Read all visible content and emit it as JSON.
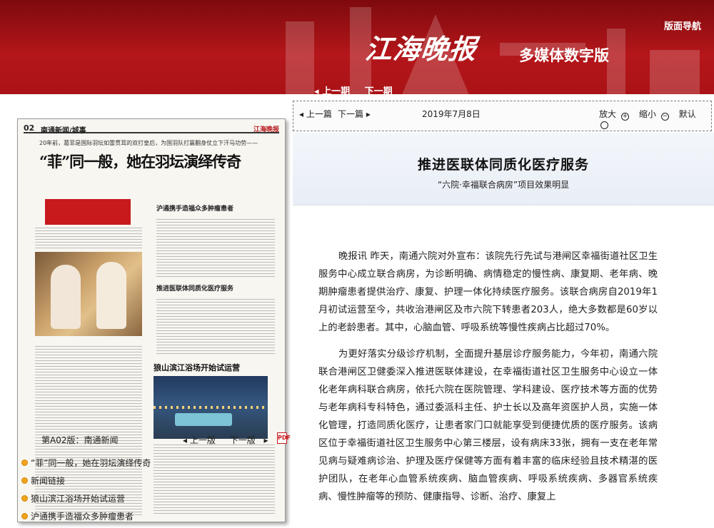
{
  "header": {
    "nav_label": "版面导航",
    "logo_text": "江海晚报",
    "logo_subtitle": "多媒体数字版",
    "issue_prev": "上一期",
    "issue_next": "下一期"
  },
  "newspaper_page": {
    "page_number": "02",
    "page_section": "南通新闻/城事",
    "brand": "江海晚报",
    "kicker": "20年前，葛菲是国际羽坛如雷贯耳的双打皇后，为国羽队打赢翻身仗立下汗马功劳——",
    "headline": "“菲”同一般，她在羽坛演绎传奇",
    "story2_title": "沪通携手造福众多肿瘤患者",
    "story3_title": "推进医联体同质化医疗服务",
    "story4_title": "狼山滨江浴场开始试运营"
  },
  "page_nav": {
    "page_info": "第A02版：南通新闻",
    "prev_page": "上一版",
    "next_page": "下一版",
    "pdf_icon": "pdf-icon"
  },
  "articles": [
    "“菲”同一般，她在羽坛演绎传奇",
    "新闻链接",
    "狼山滨江浴场开始试运营",
    "沪通携手造福众多肿瘤患者"
  ],
  "toolbar": {
    "prev_article": "上一篇",
    "next_article": "下一篇",
    "date": "2019年7月8日",
    "zoom_in": "放大",
    "zoom_out": "缩小",
    "zoom_default": "默认"
  },
  "article": {
    "title": "推进医联体同质化医疗服务",
    "subtitle": "“六院·幸福联合病房”项目效果明显",
    "paragraphs": [
      "晚报讯 昨天，南通六院对外宣布：该院先行先试与港闸区幸福街道社区卫生服务中心成立联合病房，为诊断明确、病情稳定的慢性病、康复期、老年病、晚期肿瘤患者提供治疗、康复、护理一体化持续医疗服务。该联合病房自2019年1月初试运营至今，共收治港闸区及市六院下转患者203人，绝大多数都是60岁以上的老龄患者。其中，心脑血管、呼吸系统等慢性疾病占比超过70%。",
      "为更好落实分级诊疗机制，全面提升基层诊疗服务能力，今年初，南通六院联合港闸区卫健委深入推进医联体建设，在幸福街道社区卫生服务中心设立一体化老年病科联合病房，依托六院在医院管理、学科建设、医疗技术等方面的优势与老年病科专科特色，通过委派科主任、护士长以及高年资医护人员，实施一体化管理，打造同质化医疗，让患者家门口就能享受到便捷优质的医疗服务。该病区位于幸福街道社区卫生服务中心第三楼层，设有病床33张，拥有一支在老年常见病与疑难病诊治、护理及医疗保健等方面有着丰富的临床经验且技术精湛的医护团队，在老年心血管系统疾病、脑血管疾病、呼吸系统疾病、多器官系统疾病、慢性肿瘤等的预防、健康指导、诊断、治疗、康复上"
    ]
  }
}
